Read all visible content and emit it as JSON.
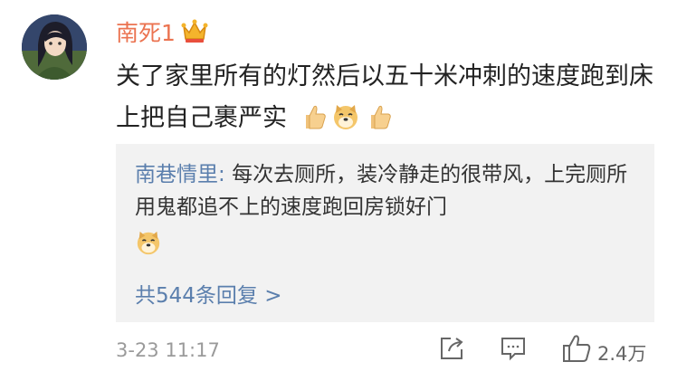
{
  "post": {
    "username": "南死1",
    "content": "关了家里所有的灯然后以五十米冲刺的速度跑到床上把自己裹严实",
    "time": "3-23 11:17",
    "like_count": "2.4万"
  },
  "reply": {
    "user": "南巷情里",
    "separator": ": ",
    "text": "每次去厕所，装冷静走的很带风，上完厕所用鬼都追不上的速度跑回房锁好门",
    "more": "共544条回复 >"
  },
  "colors": {
    "username": "#eb7350",
    "link": "#5b7fad",
    "reply_bg": "#f2f2f2",
    "meta": "#9a9a9a"
  },
  "icons": [
    "crown-icon",
    "thumbs-up-emoji",
    "doge-emoji",
    "share-icon",
    "comment-icon",
    "like-icon"
  ]
}
